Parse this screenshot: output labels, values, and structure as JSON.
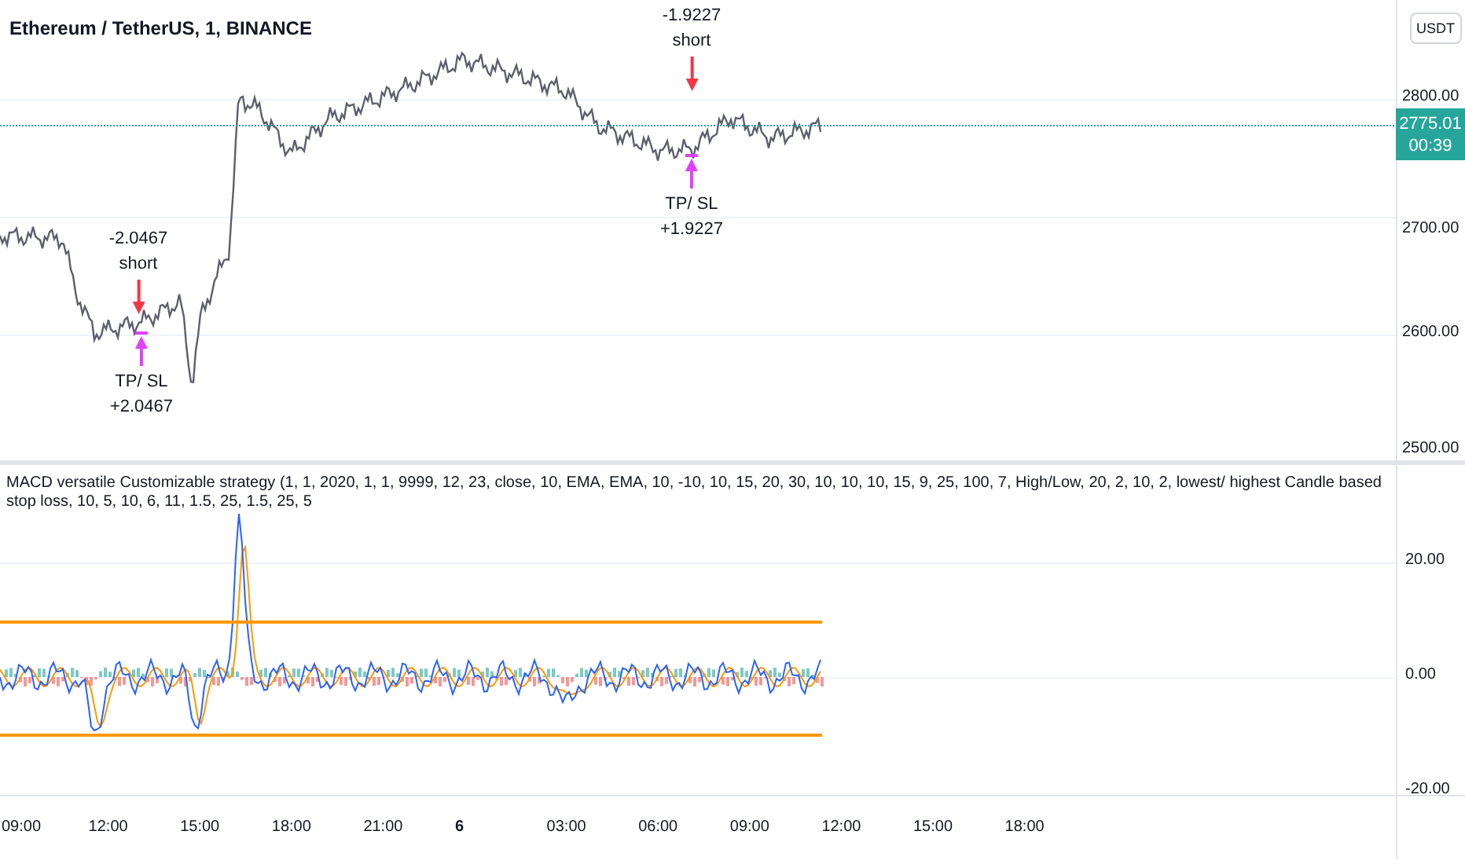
{
  "symbol_title": "Ethereum / TetherUS, 1, BINANCE",
  "currency_button": "USDT",
  "price_axis": {
    "ticks": [
      "2800.00",
      "2700.00",
      "2600.00",
      "2500.00"
    ]
  },
  "last_price": {
    "price": "2775.01",
    "countdown": "00:39"
  },
  "signals": [
    {
      "kind": "entry",
      "value": "-2.0467",
      "label": "short"
    },
    {
      "kind": "exit",
      "label": "TP/ SL",
      "value": "+2.0467"
    },
    {
      "kind": "entry",
      "value": "-1.9227",
      "label": "short"
    },
    {
      "kind": "exit",
      "label": "TP/ SL",
      "value": "+1.9227"
    }
  ],
  "indicator": {
    "title": "MACD versatile Customizable strategy (1, 1, 2020, 1, 1, 9999, 12, 23, close, 10, EMA, EMA, 10, -10, 10, 15, 20, 30, 10, 10, 10, 15, 9, 25, 100, 7, High/Low, 20, 2, 10, 2, lowest/ highest Candle based stop loss, 10, 5, 10, 6, 11, 1.5, 25, 1.5, 25, 5",
    "axis_ticks": [
      "20.00",
      "0.00",
      "-20.00"
    ]
  },
  "time_axis": {
    "labels": [
      {
        "text": "09:00",
        "emphasized": false
      },
      {
        "text": "12:00",
        "emphasized": false
      },
      {
        "text": "15:00",
        "emphasized": false
      },
      {
        "text": "18:00",
        "emphasized": false
      },
      {
        "text": "21:00",
        "emphasized": false
      },
      {
        "text": "6",
        "emphasized": true
      },
      {
        "text": "03:00",
        "emphasized": false
      },
      {
        "text": "06:00",
        "emphasized": false
      },
      {
        "text": "09:00",
        "emphasized": false
      },
      {
        "text": "12:00",
        "emphasized": false
      },
      {
        "text": "15:00",
        "emphasized": false
      },
      {
        "text": "18:00",
        "emphasized": false
      }
    ]
  }
}
